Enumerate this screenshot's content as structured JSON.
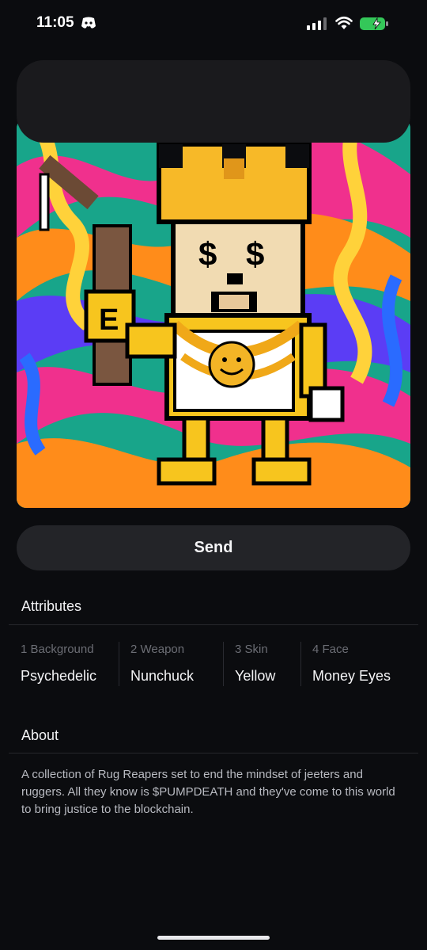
{
  "status_bar": {
    "time": "11:05",
    "icons": [
      "discord-icon",
      "cellular-signal-icon",
      "wifi-icon",
      "battery-charging-icon"
    ],
    "battery_color": "#34c759"
  },
  "nft_image": {
    "icon": "pixel-art-character"
  },
  "actions": {
    "send_label": "Send"
  },
  "attributes": {
    "title": "Attributes",
    "items": [
      {
        "label": "1 Background",
        "value": "Psychedelic"
      },
      {
        "label": "2 Weapon",
        "value": "Nunchuck"
      },
      {
        "label": "3 Skin",
        "value": "Yellow"
      },
      {
        "label": "4 Face",
        "value": "Money Eyes"
      }
    ]
  },
  "about": {
    "title": "About",
    "text": "A collection of Rug Reapers set to end the mindset of jeeters and ruggers.  All they know is $PUMPDEATH and they've come to this world to bring justice to the blockchain."
  },
  "colors": {
    "background": "#0b0c0f",
    "card": "#1a1a1d",
    "button": "#232428"
  }
}
